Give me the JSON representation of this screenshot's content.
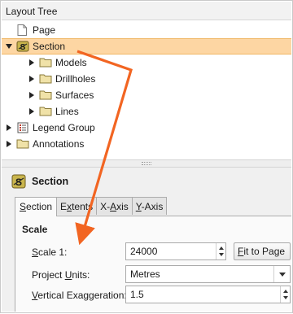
{
  "panel_title": "Layout Tree",
  "tree": {
    "page": "Page",
    "section": "Section",
    "models": "Models",
    "drillholes": "Drillholes",
    "surfaces": "Surfaces",
    "lines": "Lines",
    "legend_group": "Legend Group",
    "annotations": "Annotations"
  },
  "properties": {
    "title": "Section",
    "tabs": {
      "section": {
        "pre": "",
        "key": "S",
        "post": "ection"
      },
      "extents": {
        "pre": "E",
        "key": "x",
        "post": "tents"
      },
      "x_axis": {
        "pre": "X-",
        "key": "A",
        "post": "xis"
      },
      "y_axis": {
        "pre": "",
        "key": "Y",
        "post": "-Axis"
      }
    },
    "group": "Scale",
    "scale": {
      "pre": "",
      "key": "S",
      "post": "cale 1:",
      "value": "24000"
    },
    "fit_button": {
      "pre": "",
      "key": "F",
      "post": "it to Page"
    },
    "units": {
      "pre": "Project ",
      "key": "U",
      "post": "nits:",
      "value": "Metres"
    },
    "exaggeration": {
      "pre": "",
      "key": "V",
      "post": "ertical Exaggeration:",
      "value": "1.5"
    }
  },
  "colors": {
    "selection": "#fdd6a3",
    "arrow": "#f26522",
    "folder": "#f0e2a8"
  },
  "icons": {
    "page": "page-icon",
    "section": "section-icon",
    "folder": "folder-icon",
    "legend": "legend-icon"
  }
}
